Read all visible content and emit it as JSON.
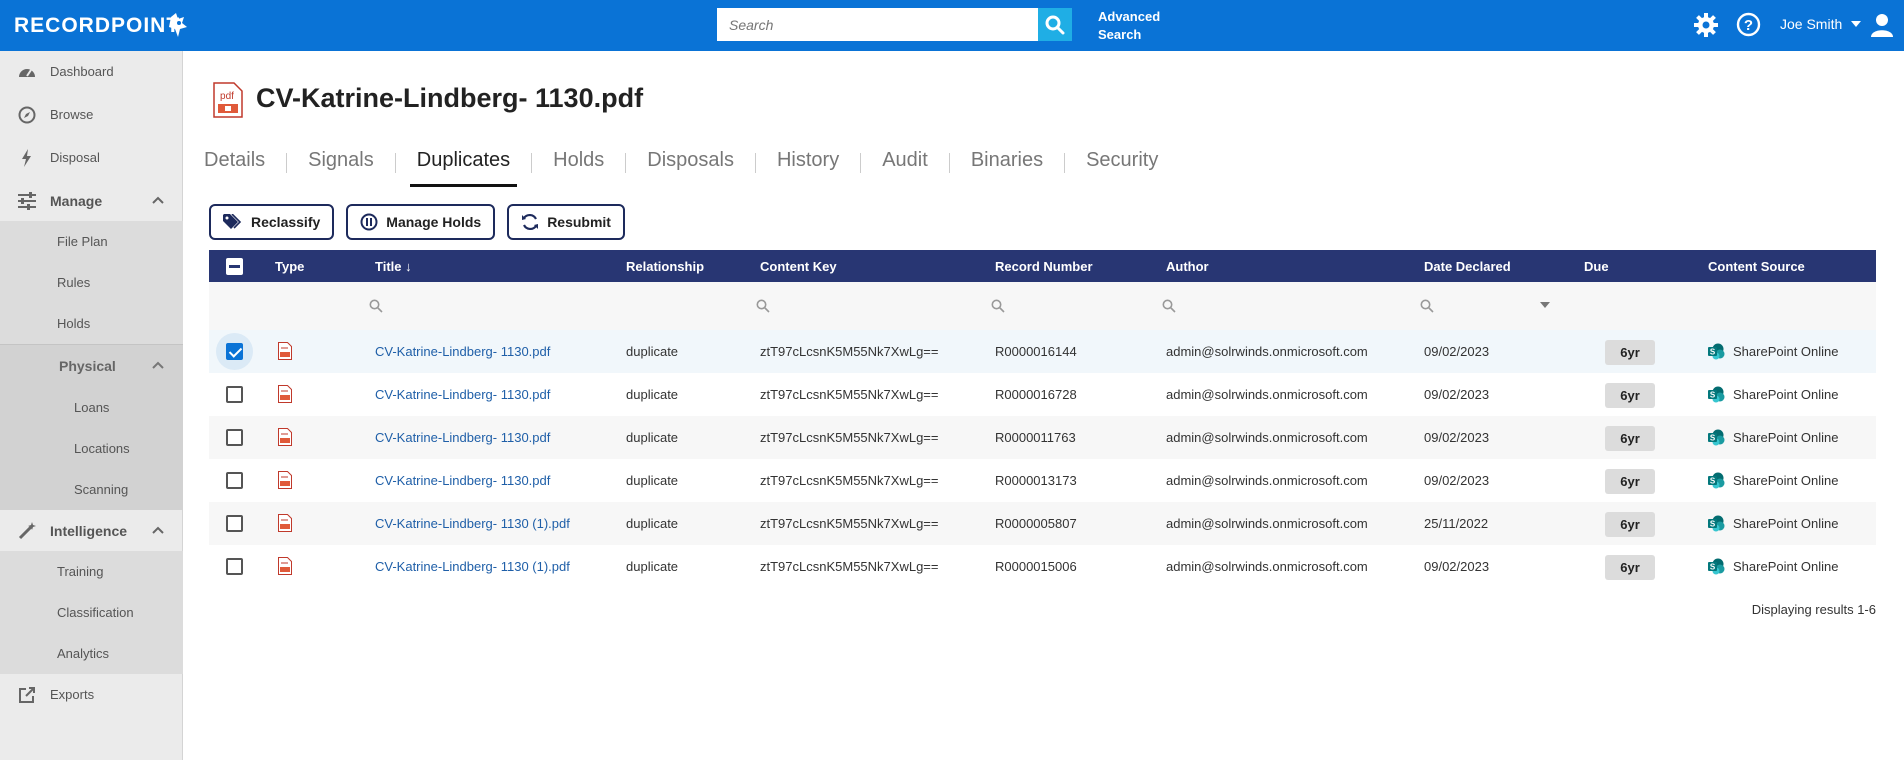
{
  "header": {
    "logo_text": "RECORDPOINT",
    "search_placeholder": "Search",
    "advanced_search_line1": "Advanced",
    "advanced_search_line2": "Search",
    "user_name": "Joe Smith"
  },
  "sidebar": {
    "dashboard": "Dashboard",
    "browse": "Browse",
    "disposal": "Disposal",
    "manage": "Manage",
    "file_plan": "File Plan",
    "rules": "Rules",
    "holds": "Holds",
    "physical": "Physical",
    "loans": "Loans",
    "locations": "Locations",
    "scanning": "Scanning",
    "intelligence": "Intelligence",
    "training": "Training",
    "classification": "Classification",
    "analytics": "Analytics",
    "exports": "Exports"
  },
  "record": {
    "title": "CV-Katrine-Lindberg- 1130.pdf",
    "file_icon_text": "pdf"
  },
  "tabs": [
    "Details",
    "Signals",
    "Duplicates",
    "Holds",
    "Disposals",
    "History",
    "Audit",
    "Binaries",
    "Security"
  ],
  "actions": {
    "reclassify": "Reclassify",
    "manage_holds": "Manage Holds",
    "resubmit": "Resubmit"
  },
  "grid": {
    "columns": {
      "type": "Type",
      "title": "Title ↓",
      "relationship": "Relationship",
      "content_key": "Content Key",
      "record_number": "Record Number",
      "author": "Author",
      "date_declared": "Date Declared",
      "due": "Due",
      "content_source": "Content Source"
    },
    "rows": [
      {
        "title": "CV-Katrine-Lindberg- 1130.pdf",
        "relationship": "duplicate",
        "content_key": "ztT97cLcsnK5M55Nk7XwLg==",
        "record_number": "R0000016144",
        "author": "admin@solrwinds.onmicrosoft.com",
        "date_declared": "09/02/2023",
        "due": "6yr",
        "content_source": "SharePoint Online",
        "checked": true
      },
      {
        "title": "CV-Katrine-Lindberg- 1130.pdf",
        "relationship": "duplicate",
        "content_key": "ztT97cLcsnK5M55Nk7XwLg==",
        "record_number": "R0000016728",
        "author": "admin@solrwinds.onmicrosoft.com",
        "date_declared": "09/02/2023",
        "due": "6yr",
        "content_source": "SharePoint Online",
        "checked": false
      },
      {
        "title": "CV-Katrine-Lindberg- 1130.pdf",
        "relationship": "duplicate",
        "content_key": "ztT97cLcsnK5M55Nk7XwLg==",
        "record_number": "R0000011763",
        "author": "admin@solrwinds.onmicrosoft.com",
        "date_declared": "09/02/2023",
        "due": "6yr",
        "content_source": "SharePoint Online",
        "checked": false
      },
      {
        "title": "CV-Katrine-Lindberg- 1130.pdf",
        "relationship": "duplicate",
        "content_key": "ztT97cLcsnK5M55Nk7XwLg==",
        "record_number": "R0000013173",
        "author": "admin@solrwinds.onmicrosoft.com",
        "date_declared": "09/02/2023",
        "due": "6yr",
        "content_source": "SharePoint Online",
        "checked": false
      },
      {
        "title": "CV-Katrine-Lindberg- 1130 (1).pdf",
        "relationship": "duplicate",
        "content_key": "ztT97cLcsnK5M55Nk7XwLg==",
        "record_number": "R0000005807",
        "author": "admin@solrwinds.onmicrosoft.com",
        "date_declared": "25/11/2022",
        "due": "6yr",
        "content_source": "SharePoint Online",
        "checked": false
      },
      {
        "title": "CV-Katrine-Lindberg- 1130 (1).pdf",
        "relationship": "duplicate",
        "content_key": "ztT97cLcsnK5M55Nk7XwLg==",
        "record_number": "R0000015006",
        "author": "admin@solrwinds.onmicrosoft.com",
        "date_declared": "09/02/2023",
        "due": "6yr",
        "content_source": "SharePoint Online",
        "checked": false
      }
    ],
    "results_text": "Displaying results 1-6"
  },
  "colors": {
    "topbar": "#0a73d6",
    "grid_header": "#283673",
    "link": "#1f5fa8",
    "search_button": "#1faee5"
  }
}
